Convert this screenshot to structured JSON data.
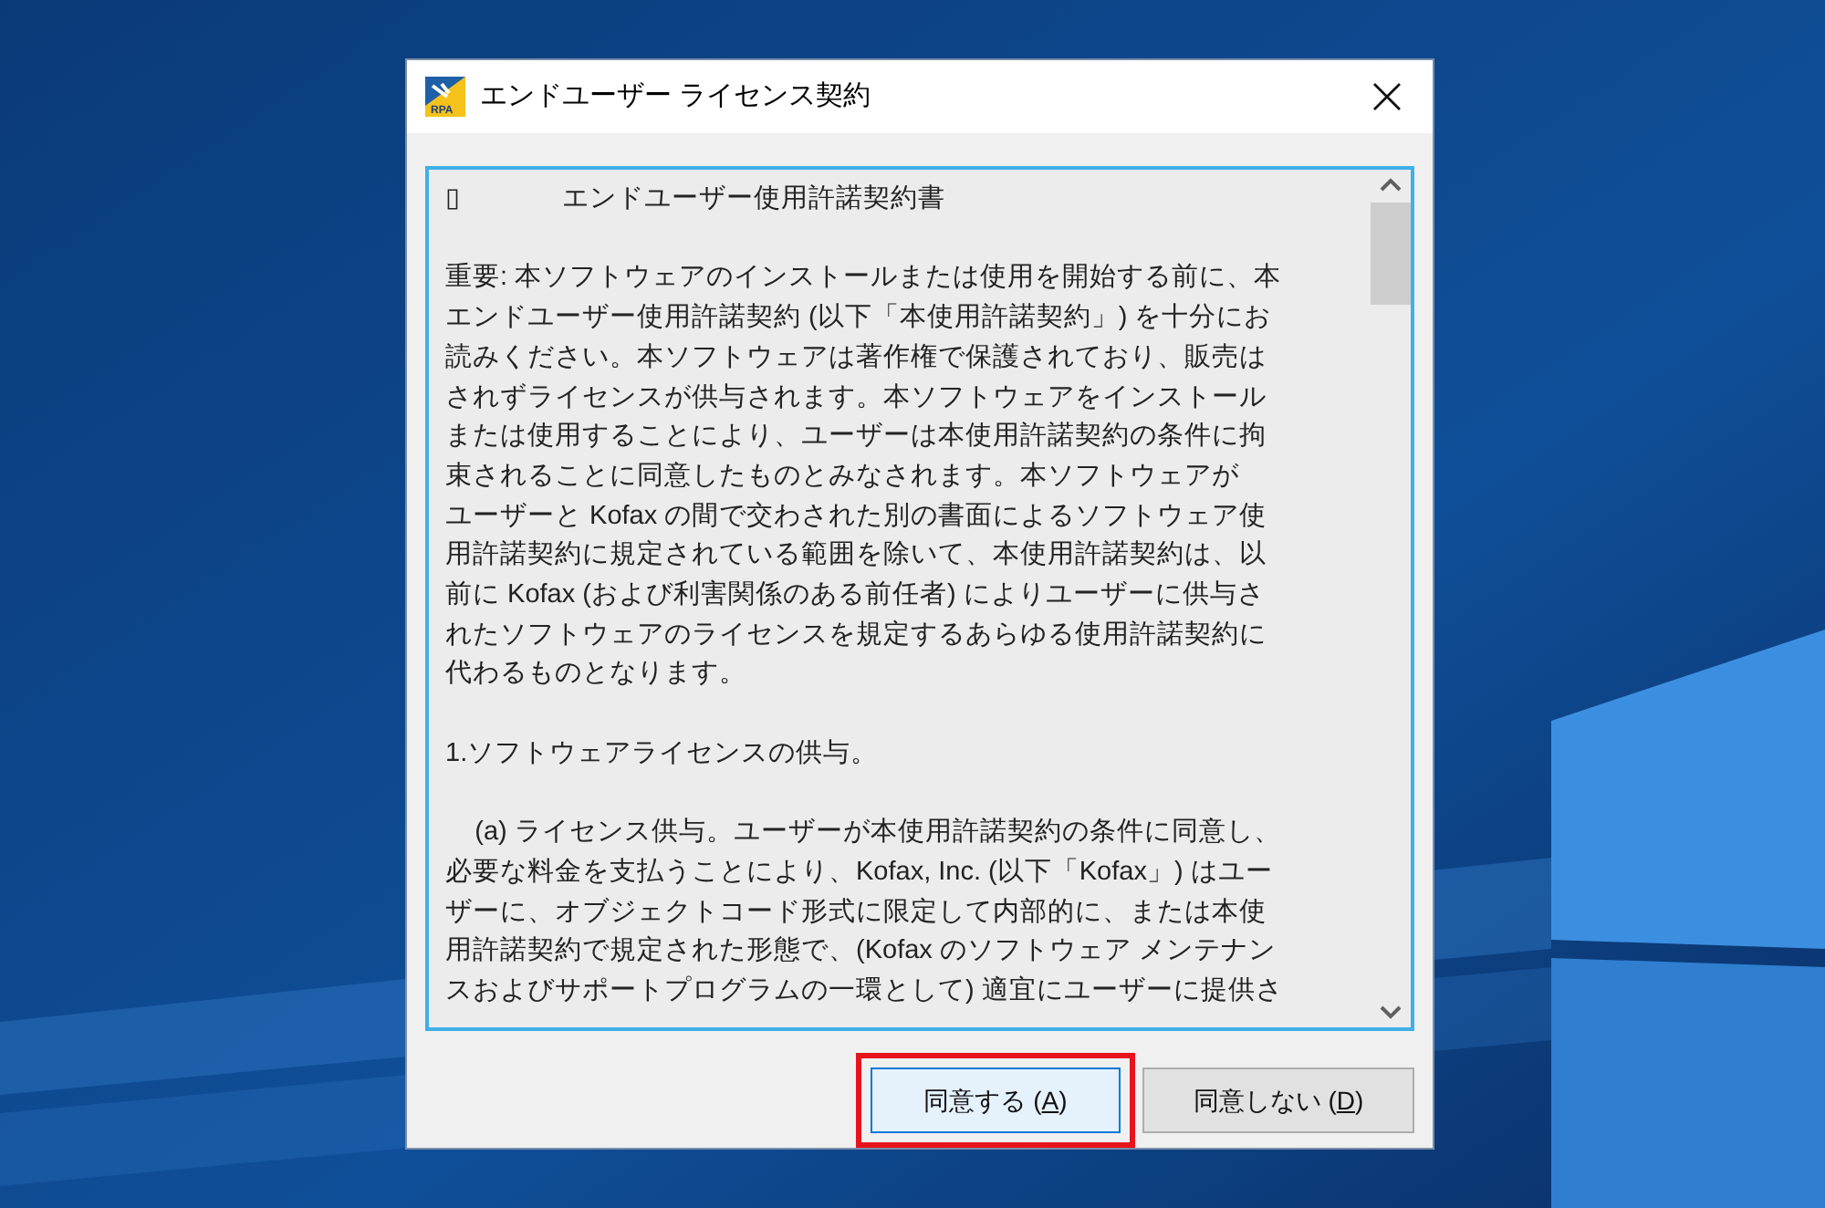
{
  "window": {
    "title": "エンドユーザー ライセンス契約",
    "icon_text": "RPA"
  },
  "document": {
    "heading_glyph": "▯",
    "heading": "エンドユーザー使用許諾契約書",
    "paragraphs": [
      {
        "lines": [
          "重要: 本ソフトウェアのインストールまたは使用を開始する前に、本",
          "エンドユーザー使用許諾契約 (以下「本使用許諾契約」) を十分にお",
          "読みください。本ソフトウェアは著作権で保護されており、販売は",
          "されずライセンスが供与されます。本ソフトウェアをインストール",
          "または使用することにより、ユーザーは本使用許諾契約の条件に拘",
          "束されることに同意したものとみなされます。本ソフトウェアが",
          "ユーザーと Kofax の間で交わされた別の書面によるソフトウェア使",
          "用許諾契約に規定されている範囲を除いて、本使用許諾契約は、以",
          "前に Kofax (および利害関係のある前任者) によりユーザーに供与さ",
          "れたソフトウェアのライセンスを規定するあらゆる使用許諾契約に",
          "代わるものとなります。"
        ]
      },
      {
        "lines": [
          "1.ソフトウェアライセンスの供与。"
        ]
      },
      {
        "lines": [
          "    (a) ライセンス供与。ユーザーが本使用許諾契約の条件に同意し、",
          "必要な料金を支払うことにより、Kofax, Inc. (以下「Kofax」) はユー",
          "ザーに、オブジェクトコード形式に限定して内部的に、または本使",
          "用許諾契約で規定された形態で、(Kofax のソフトウェア メンテナン",
          "スおよびサポートプログラムの一環として) 適宜にユーザーに提供さ"
        ]
      }
    ]
  },
  "buttons": [
    {
      "label_before": "同意する (",
      "mnemonic": "A",
      "label_after": ")",
      "default": true,
      "highlighted": true
    },
    {
      "label_before": "同意しない (",
      "mnemonic": "D",
      "label_after": ")",
      "default": false,
      "highlighted": false
    }
  ]
}
